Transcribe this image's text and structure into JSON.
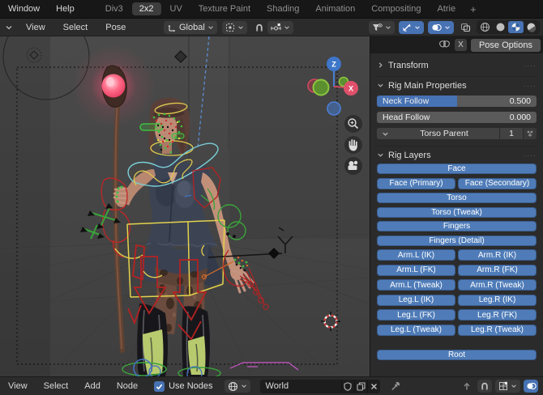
{
  "topbar": {
    "menus": [
      "Window",
      "Help"
    ],
    "workspaces": [
      "Div3",
      "2x2",
      "UV",
      "Texture Paint",
      "Shading",
      "Animation",
      "Compositing",
      "Atrie"
    ],
    "active_workspace": "2x2",
    "add_workspace": "+"
  },
  "viewport_header": {
    "menus": [
      "View",
      "Select",
      "Pose"
    ],
    "orientation": {
      "value": "Global"
    }
  },
  "tool_settings": {
    "mirror_x": "X",
    "pose_options": "Pose Options"
  },
  "viewport": {
    "gizmo": {
      "z": "Z",
      "x": "X"
    }
  },
  "sidebar": {
    "transform_panel": {
      "title": "Transform"
    },
    "rig_main": {
      "title": "Rig Main Properties",
      "neck_follow": {
        "label": "Neck Follow",
        "value": "0.500",
        "fill_css": "width:50%"
      },
      "head_follow": {
        "label": "Head Follow",
        "value": "0.000",
        "fill_css": "width:0%"
      },
      "torso_parent": {
        "label": "Torso Parent",
        "value": "1"
      }
    },
    "rig_layers": {
      "title": "Rig Layers",
      "buttons": [
        "Face",
        "Face (Primary)",
        "Face (Secondary)",
        "Torso",
        "Torso (Tweak)",
        "Fingers",
        "Fingers (Detail)",
        "Arm.L (IK)",
        "Arm.R (IK)",
        "Arm.L (FK)",
        "Arm.R (FK)",
        "Arm.L (Tweak)",
        "Arm.R (Tweak)",
        "Leg.L (IK)",
        "Leg.R (IK)",
        "Leg.L (FK)",
        "Leg.R (FK)",
        "Leg.L (Tweak)",
        "Leg.R (Tweak)",
        "Root"
      ]
    }
  },
  "bottom_bar": {
    "menus": [
      "View",
      "Select",
      "Add",
      "Node"
    ],
    "use_nodes": {
      "label": "Use Nodes",
      "checked": true
    },
    "world": {
      "name": "World"
    }
  },
  "colors": {
    "accent_blue": "#4772b3",
    "rig_button_blue": "#4f7cb8",
    "orb_pink": "#ff5b7e",
    "topbar_bg": "#171717",
    "header_bg": "#2b2b2b",
    "viewport_bg": "#454545",
    "slider_track": "#5a5a5a",
    "field_bg": "#1d1d1d"
  }
}
